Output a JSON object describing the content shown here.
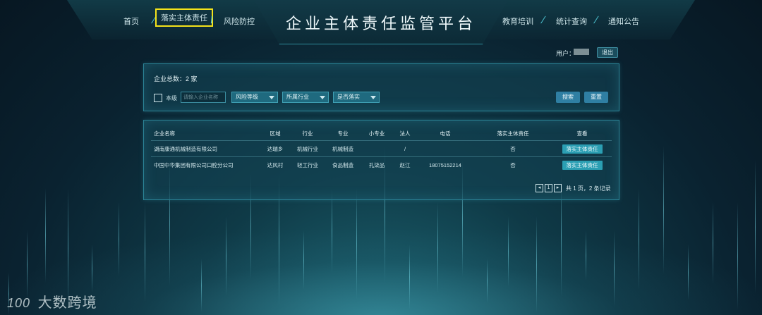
{
  "header": {
    "title": "企业主体责任监管平台",
    "nav_left": [
      "首页",
      "落实主体责任",
      "风险防控"
    ],
    "nav_right": [
      "教育培训",
      "统计查询",
      "通知公告"
    ]
  },
  "user": {
    "label": "用户：",
    "logout": "退出"
  },
  "search": {
    "total_label": "企业总数：2 家",
    "checkbox_label": "本级",
    "name_placeholder": "请输入企业名称",
    "risk_level": "风险等级",
    "industry": "所属行业",
    "implemented": "是否落实",
    "search_button": "搜索",
    "reset_button": "重置"
  },
  "table": {
    "headers": [
      "企业名称",
      "区域",
      "行业",
      "专业",
      "小专业",
      "法人",
      "电话",
      "落实主体责任",
      "查看"
    ],
    "rows": [
      {
        "name": "湖南康通机械制造有限公司",
        "region": "达瑞乡",
        "industry": "机械行业",
        "major": "机械制造",
        "sub_major": "",
        "legal": "/",
        "phone": "",
        "implemented": "否",
        "action": "落实主体责任"
      },
      {
        "name": "中国中华集团有限公司口腔分公司",
        "region": "达风村",
        "industry": "轻工行业",
        "major": "食品制造",
        "sub_major": "孔柒品",
        "legal": "赵江",
        "phone": "18075152214",
        "implemented": "否",
        "action": "落实主体责任"
      }
    ]
  },
  "pager": {
    "current": "1",
    "summary": "共 1 页，2 条记录"
  },
  "watermark": {
    "logo": "100",
    "text": "大数跨境"
  }
}
